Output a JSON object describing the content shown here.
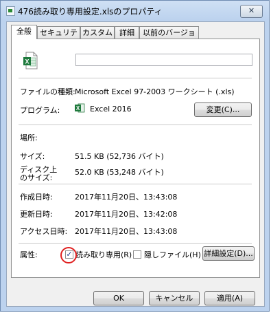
{
  "window": {
    "title": "476読み取り専用設定.xlsのプロパティ",
    "close_label": "✕"
  },
  "tabs": [
    "全般",
    "セキュリティ",
    "カスタム",
    "詳細",
    "以前のバージョン"
  ],
  "general": {
    "file_name_value": "",
    "file_type_label": "ファイルの種類:",
    "file_type_value": "Microsoft Excel 97-2003 ワークシート (.xls)",
    "program_label": "プログラム:",
    "program_value": "Excel 2016",
    "change_button": "変更(C)...",
    "location_label": "場所:",
    "location_value": "",
    "size_label": "サイズ:",
    "size_value": "51.5 KB (52,736 バイト)",
    "disk_size_label_line1": "ディスク上",
    "disk_size_label_line2": "のサイズ:",
    "disk_size_value": "52.0 KB (53,248 バイト)",
    "created_label": "作成日時:",
    "created_value": "2017年11月20日、13:43:08",
    "modified_label": "更新日時:",
    "modified_value": "2017年11月20日、13:42:08",
    "accessed_label": "アクセス日時:",
    "accessed_value": "2017年11月20日、13:43:08",
    "attributes_label": "属性:",
    "readonly_label": "読み取り専用(R)",
    "readonly_checked": true,
    "hidden_label": "隠しファイル(H)",
    "hidden_checked": false,
    "advanced_button": "詳細設定(D)..."
  },
  "footer": {
    "ok": "OK",
    "cancel": "キャンセル",
    "apply": "適用(A)"
  },
  "colors": {
    "excel_green": "#1f7a3d",
    "highlight_circle": "#e01f1f"
  }
}
